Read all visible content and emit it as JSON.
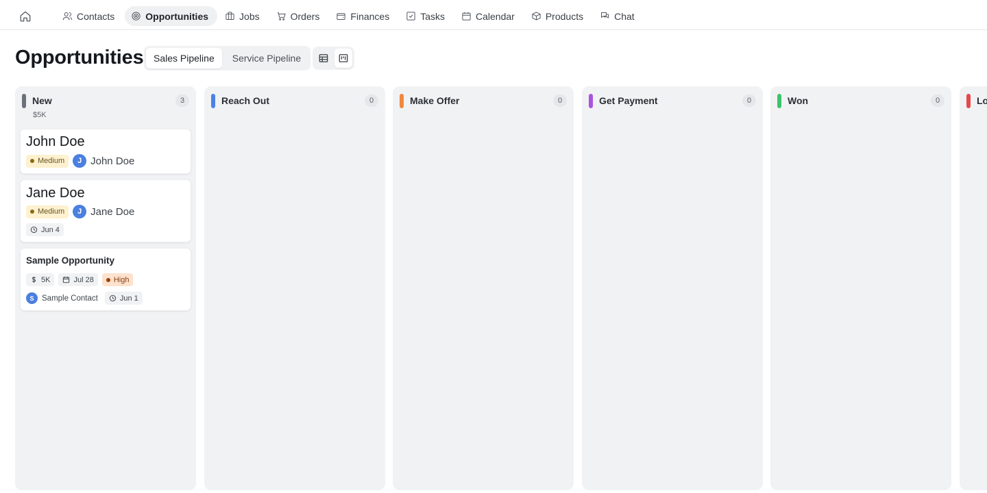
{
  "nav": {
    "home_icon": "home-icon",
    "items": [
      {
        "label": "Contacts",
        "icon": "users-icon",
        "active": false
      },
      {
        "label": "Opportunities",
        "icon": "target-icon",
        "active": true
      },
      {
        "label": "Jobs",
        "icon": "briefcase-icon",
        "active": false
      },
      {
        "label": "Orders",
        "icon": "cart-icon",
        "active": false
      },
      {
        "label": "Finances",
        "icon": "wallet-icon",
        "active": false
      },
      {
        "label": "Tasks",
        "icon": "checkbox-icon",
        "active": false
      },
      {
        "label": "Calendar",
        "icon": "calendar-icon",
        "active": false
      },
      {
        "label": "Products",
        "icon": "package-icon",
        "active": false
      },
      {
        "label": "Chat",
        "icon": "chat-icon",
        "active": false
      }
    ]
  },
  "header": {
    "title": "Opportunities",
    "pipelines": [
      {
        "label": "Sales Pipeline",
        "active": true
      },
      {
        "label": "Service Pipeline",
        "active": false
      }
    ],
    "views": [
      {
        "icon": "table-view-icon",
        "active": false
      },
      {
        "icon": "kanban-view-icon",
        "active": true
      }
    ]
  },
  "columns": [
    {
      "title": "New",
      "count": "3",
      "total": "$5K",
      "color": "#6b7079"
    },
    {
      "title": "Reach Out",
      "count": "0",
      "total": "",
      "color": "#4b82e6"
    },
    {
      "title": "Make Offer",
      "count": "0",
      "total": "",
      "color": "#f0883e"
    },
    {
      "title": "Get Payment",
      "count": "0",
      "total": "",
      "color": "#a855e0"
    },
    {
      "title": "Won",
      "count": "0",
      "total": "",
      "color": "#3cc46a"
    },
    {
      "title": "Lo",
      "count": "",
      "total": "",
      "color": "#e5484d"
    }
  ],
  "cards": [
    {
      "title": "John Doe",
      "priority": "Medium",
      "avatar_initial": "J",
      "contact": "John Doe"
    },
    {
      "title": "Jane Doe",
      "priority": "Medium",
      "avatar_initial": "J",
      "contact": "Jane Doe",
      "date": "Jun 4"
    },
    {
      "title": "Sample Opportunity",
      "value": "5K",
      "close_date": "Jul 28",
      "priority": "High",
      "avatar_initial": "S",
      "contact": "Sample Contact",
      "date": "Jun 1"
    }
  ]
}
